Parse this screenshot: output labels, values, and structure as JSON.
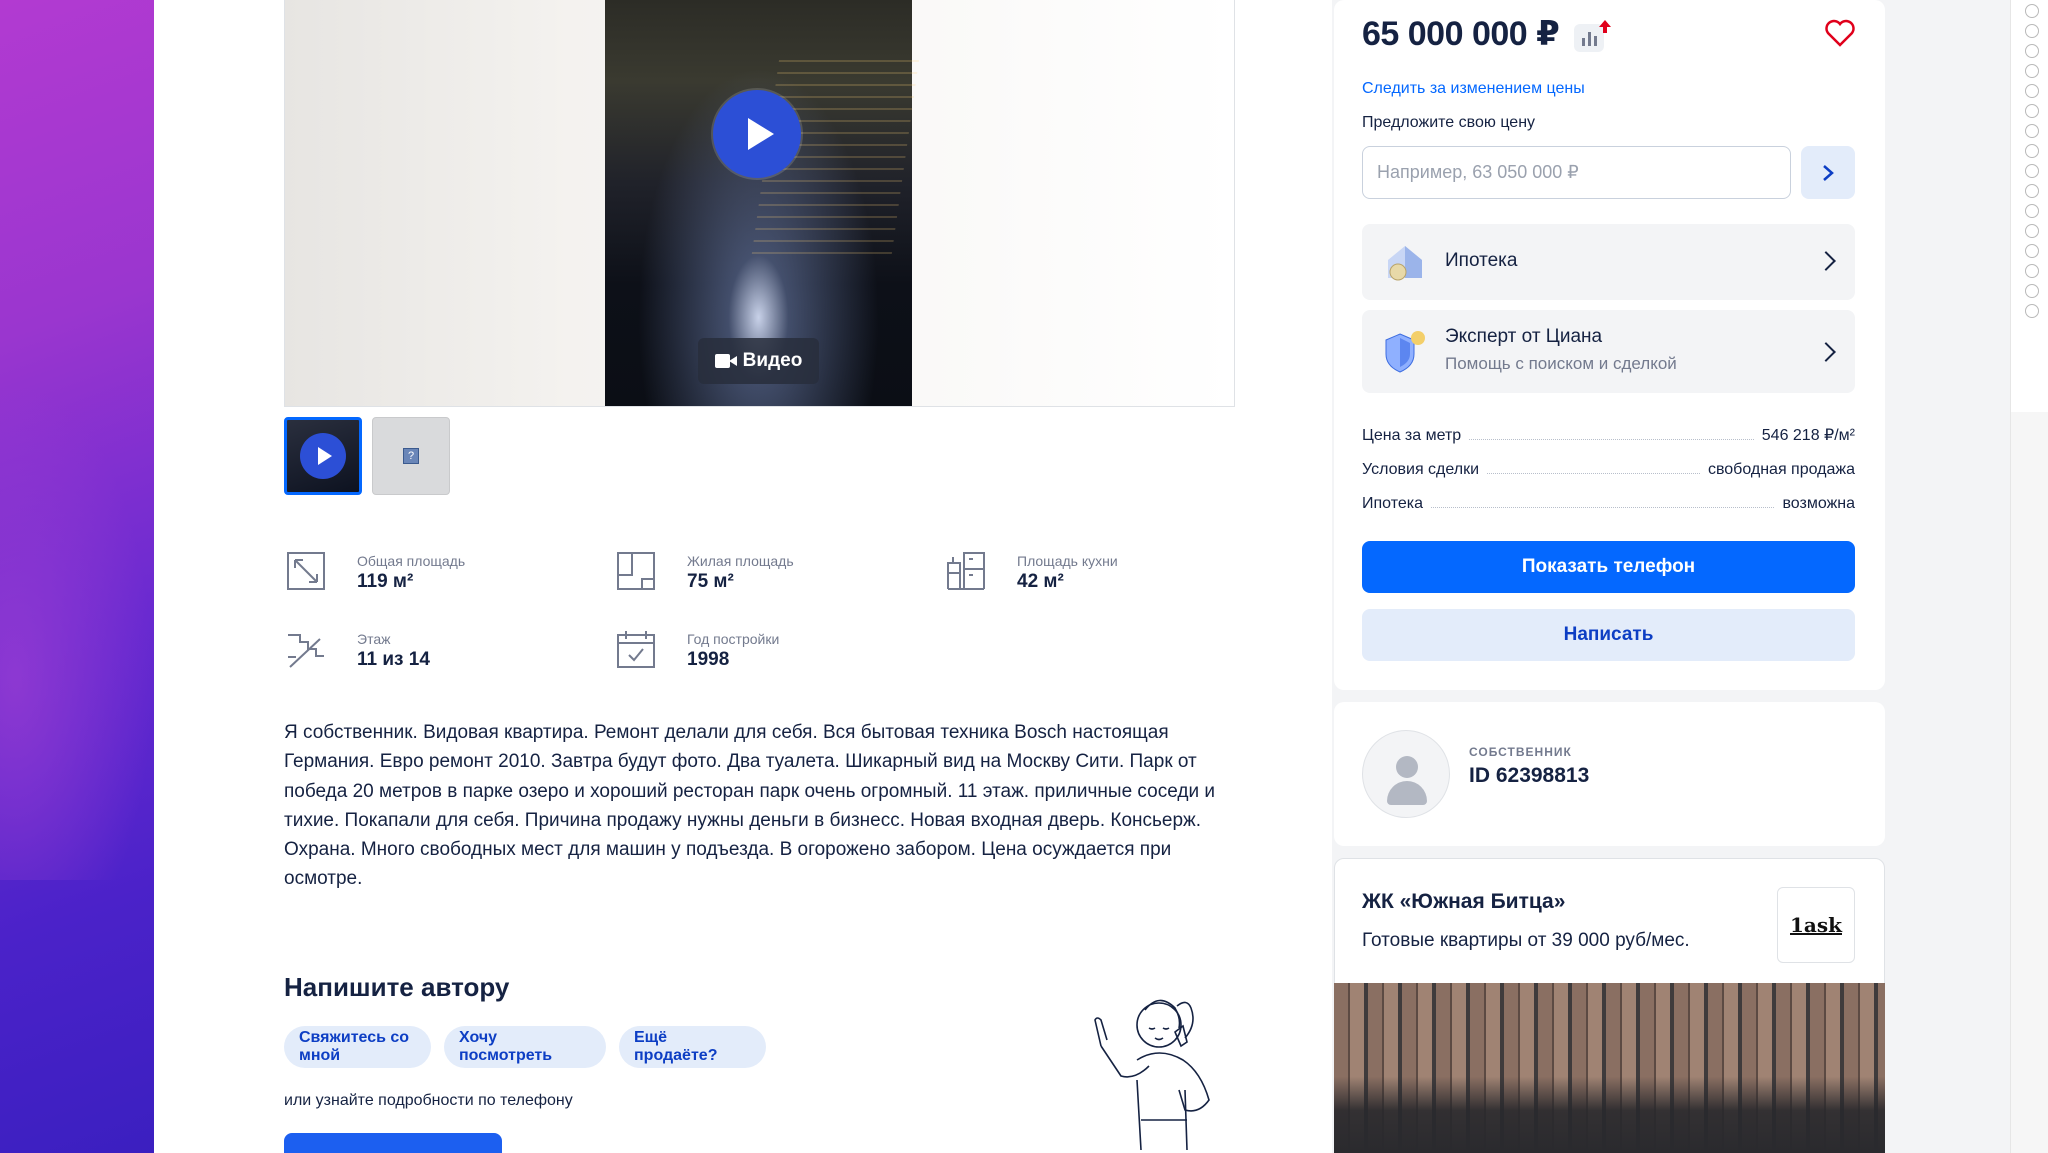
{
  "gallery": {
    "video_badge": "Видео"
  },
  "features": [
    {
      "label": "Общая площадь",
      "value": "119 м²",
      "icon": "area-icon"
    },
    {
      "label": "Жилая площадь",
      "value": "75 м²",
      "icon": "living-area-icon"
    },
    {
      "label": "Площадь кухни",
      "value": "42 м²",
      "icon": "kitchen-icon"
    },
    {
      "label": "Этаж",
      "value": "11 из 14",
      "icon": "stairs-icon"
    },
    {
      "label": "Год постройки",
      "value": "1998",
      "icon": "calendar-icon"
    }
  ],
  "description": "Я собственник. Видовая квартира. Ремонт делали для себя. Вся бытовая техника Bosch настоящая Германия. Евро ремонт 2010. Завтра будут фото. Два туалета. Шикарный вид на Москву Сити. Парк от победа 20 метров в парке озеро и хороший ресторан парк очень огромный. 11 этаж. приличные соседи и тихие. Покапали для себя. Причина продажу нужны деньги  в бизнесс. Новая входная дверь. Консьерж. Охрана. Много свободных мест для машин у подъезда.  В огорожено забором. Цена осуждается при осмотре.",
  "write_author": {
    "title": "Напишите автору",
    "chips": [
      "Свяжитесь со мной",
      "Хочу посмотреть",
      "Ещё продаёте?"
    ],
    "or_phone": "или узнайте подробности по телефону"
  },
  "sidebar": {
    "price": "65 000 000 ₽",
    "follow_link": "Следить за изменением цены",
    "offer_label": "Предложите свою цену",
    "offer_placeholder": "Например, 63 050 000 ₽",
    "mortgage": {
      "title": "Ипотека"
    },
    "expert": {
      "title": "Эксперт от Циана",
      "subtitle": "Помощь с поиском и сделкой"
    },
    "details": [
      {
        "key": "Цена за метр",
        "value": "546 218 ₽/м²"
      },
      {
        "key": "Условия сделки",
        "value": "свободная продажа"
      },
      {
        "key": "Ипотека",
        "value": "возможна"
      }
    ],
    "show_phone": "Показать телефон",
    "write": "Написать"
  },
  "owner": {
    "label": "СОБСТВЕННИК",
    "id": "ID 62398813"
  },
  "jk": {
    "title": "ЖК «Южная Битца»",
    "subtitle": "Готовые квартиры от 39 000 руб/мес.",
    "logo_text": "1ask"
  },
  "colors": {
    "accent": "#0468ff",
    "accent_light": "#e3ecfa",
    "text": "#152242",
    "muted": "#737a8e",
    "price_up": "#e0001b"
  }
}
